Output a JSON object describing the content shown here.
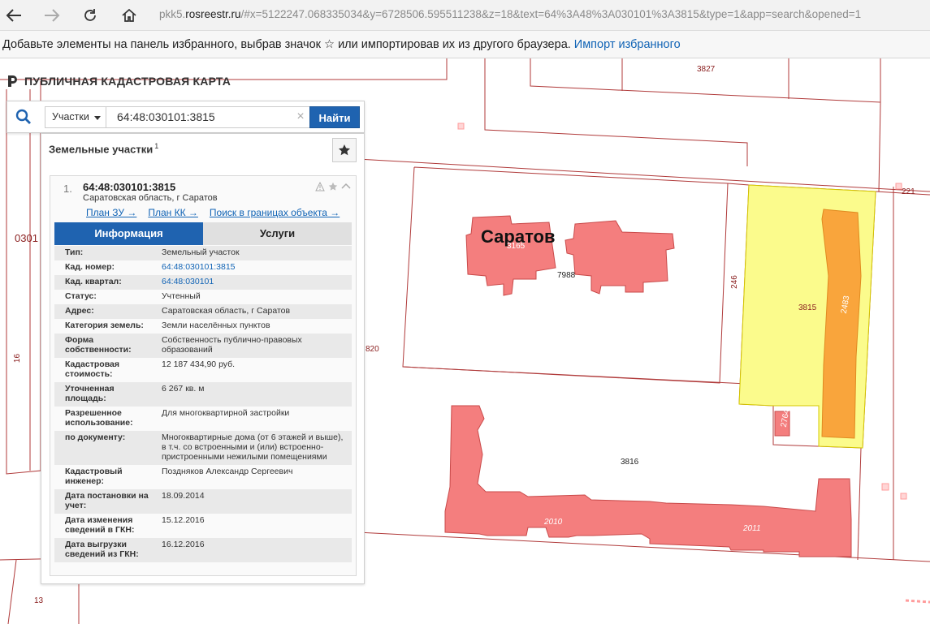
{
  "browser": {
    "url_prefix": "pkk5.",
    "url_domain": "rosreestr.ru",
    "url_rest": "/#x=5122247.068335034&y=6728506.595511238&z=18&text=64%3A48%3A030101%3A3815&type=1&app=search&opened=1"
  },
  "favorites_bar": {
    "text": "Добавьте элементы на панель избранного, выбрав значок ☆ или импортировав их из другого браузера.",
    "import_link": "Импорт избранного"
  },
  "brand": {
    "title": "ПУБЛИЧНАЯ КАДАСТРОВАЯ КАРТА"
  },
  "search": {
    "type_label": "Участки",
    "query": "64:48:030101:3815",
    "clear": "×",
    "find_label": "Найти"
  },
  "results": {
    "title": "Земельные участки",
    "count": "1",
    "item": {
      "index": "1.",
      "cad_number": "64:48:030101:3815",
      "address": "Саратовская область, г Саратов",
      "links": [
        "План ЗУ →",
        "План КК →",
        "Поиск в границах объекта →"
      ]
    },
    "tabs": {
      "info": "Информация",
      "services": "Услуги"
    },
    "rows": [
      {
        "k": "Тип:",
        "v": "Земельный участок"
      },
      {
        "k": "Кад. номер:",
        "v": "64:48:030101:3815"
      },
      {
        "k": "Кад. квартал:",
        "v": "64:48:030101"
      },
      {
        "k": "Статус:",
        "v": "Учтенный"
      },
      {
        "k": "Адрес:",
        "v": "Саратовская область, г Саратов"
      },
      {
        "k": "Категория земель:",
        "v": "Земли населённых пунктов"
      },
      {
        "k": "Форма собственности:",
        "v": "Собственность публично-правовых образований"
      },
      {
        "k": "Кадастровая стоимость:",
        "v": "12 187 434,90 руб."
      },
      {
        "k": "Уточненная площадь:",
        "v": "6 267 кв. м"
      },
      {
        "k": "Разрешенное использование:",
        "v": "Для многоквартирной застройки"
      },
      {
        "k": "по документу:",
        "v": "Многоквартирные дома (от 6 этажей и выше), в т.ч. со встроенными и (или) встроенно-пристроенными нежилыми помещениями"
      },
      {
        "k": "Кадастровый инженер:",
        "v": "Поздняков Александр Сергеевич"
      },
      {
        "k": "Дата постановки на учет:",
        "v": "18.09.2014"
      },
      {
        "k": "Дата изменения сведений в ГКН:",
        "v": "15.12.2016"
      },
      {
        "k": "Дата выгрузки сведений из ГКН:",
        "v": "16.12.2016"
      }
    ]
  },
  "map": {
    "city": "Саратов",
    "labels": [
      "3827",
      "221",
      "0301",
      "16",
      "820",
      "246",
      "3815",
      "2483",
      "7988",
      "3165",
      "3816",
      "2764",
      "2010",
      "2011",
      "13"
    ],
    "colors": {
      "parcel_line": "#b03a3a",
      "building": "#f47e7e",
      "selected": "#fbfb8c",
      "highlight": "#f9a53c"
    }
  }
}
